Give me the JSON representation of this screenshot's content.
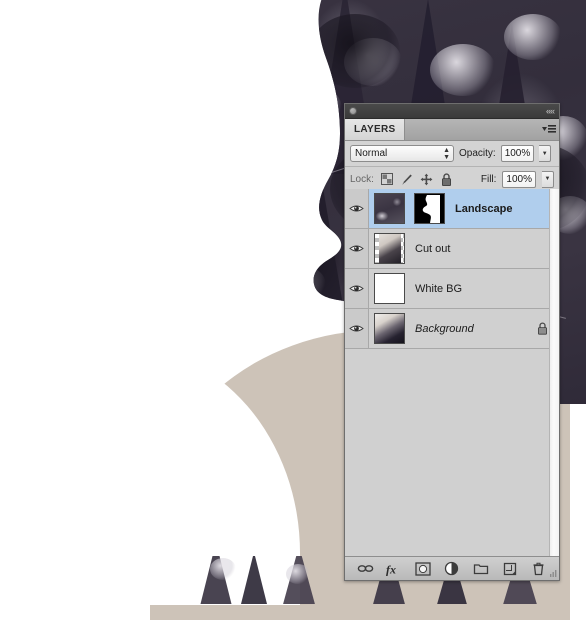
{
  "app": {
    "panel_title": "LAYERS",
    "collapse_arrows": "««"
  },
  "blend_row": {
    "mode": "Normal",
    "opacity_label": "Opacity:",
    "opacity_value": "100%"
  },
  "lock_row": {
    "lock_label": "Lock:",
    "fill_label": "Fill:",
    "fill_value": "100%",
    "icons": [
      "transparency-lock-icon",
      "brush-lock-icon",
      "move-lock-icon",
      "all-lock-icon"
    ]
  },
  "layers": [
    {
      "name": "Landscape",
      "selected": true,
      "visible": true,
      "style": "bold",
      "has_mask": true,
      "locked": false,
      "thumb": "landscape-thumbnail",
      "mask_thumb": "layer-mask-thumbnail"
    },
    {
      "name": "Cut out",
      "selected": false,
      "visible": true,
      "style": "normal",
      "has_mask": false,
      "locked": false,
      "thumb": "cutout-thumbnail"
    },
    {
      "name": "White BG",
      "selected": false,
      "visible": true,
      "style": "normal",
      "has_mask": false,
      "locked": false,
      "thumb": "white-thumbnail"
    },
    {
      "name": "Background",
      "selected": false,
      "visible": true,
      "style": "italic",
      "has_mask": false,
      "locked": true,
      "thumb": "background-thumbnail"
    }
  ],
  "footer_icons": [
    "link-layers-icon",
    "layer-style-fx-icon",
    "add-layer-mask-icon",
    "adjustment-layer-icon",
    "new-group-icon",
    "new-layer-icon",
    "delete-layer-icon"
  ],
  "colors": {
    "panel_bg": "#d6d6d6",
    "list_bg": "#d0d0d0",
    "selected_row": "#b0ceed",
    "titlebar": "#3a3a3a",
    "shoulder": "#cdc3b8",
    "forest_dark": "#3b3543"
  }
}
